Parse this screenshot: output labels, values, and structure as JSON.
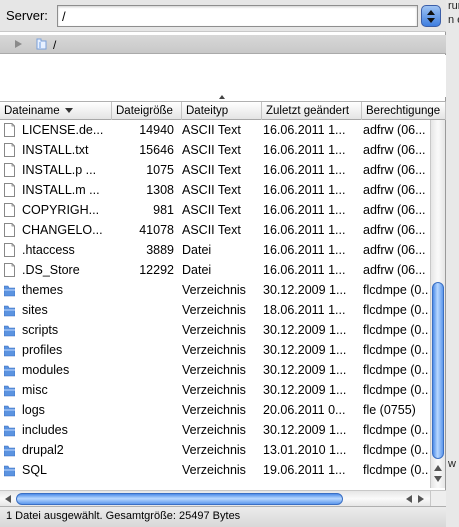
{
  "server": {
    "label": "Server:",
    "value": "/"
  },
  "path": {
    "text": "/"
  },
  "columns": [
    "Dateiname",
    "Dateigröße",
    "Dateityp",
    "Zuletzt geändert",
    "Berechtigunge"
  ],
  "files": [
    {
      "name": "LICENSE.de...",
      "size": "14940",
      "type": "ASCII Text",
      "modified": "16.06.2011 1...",
      "perm": "adfrw (06...",
      "kind": "file"
    },
    {
      "name": "INSTALL.txt",
      "size": "15646",
      "type": "ASCII Text",
      "modified": "16.06.2011 1...",
      "perm": "adfrw (06...",
      "kind": "file"
    },
    {
      "name": "INSTALL.p ...",
      "size": "1075",
      "type": "ASCII Text",
      "modified": "16.06.2011 1...",
      "perm": "adfrw (06...",
      "kind": "file"
    },
    {
      "name": "INSTALL.m ...",
      "size": "1308",
      "type": "ASCII Text",
      "modified": "16.06.2011 1...",
      "perm": "adfrw (06...",
      "kind": "file"
    },
    {
      "name": "COPYRIGH...",
      "size": "981",
      "type": "ASCII Text",
      "modified": "16.06.2011 1...",
      "perm": "adfrw (06...",
      "kind": "file"
    },
    {
      "name": "CHANGELO...",
      "size": "41078",
      "type": "ASCII Text",
      "modified": "16.06.2011 1...",
      "perm": "adfrw (06...",
      "kind": "file"
    },
    {
      "name": ".htaccess",
      "size": "3889",
      "type": "Datei",
      "modified": "16.06.2011 1...",
      "perm": "adfrw (06...",
      "kind": "file"
    },
    {
      "name": ".DS_Store",
      "size": "12292",
      "type": "Datei",
      "modified": "16.06.2011 1...",
      "perm": "adfrw (06...",
      "kind": "file"
    },
    {
      "name": "themes",
      "size": "",
      "type": "Verzeichnis",
      "modified": "30.12.2009 1...",
      "perm": "flcdmpe (0...",
      "kind": "folder"
    },
    {
      "name": "sites",
      "size": "",
      "type": "Verzeichnis",
      "modified": "18.06.2011 1...",
      "perm": "flcdmpe (0...",
      "kind": "folder"
    },
    {
      "name": "scripts",
      "size": "",
      "type": "Verzeichnis",
      "modified": "30.12.2009 1...",
      "perm": "flcdmpe (0...",
      "kind": "folder"
    },
    {
      "name": "profiles",
      "size": "",
      "type": "Verzeichnis",
      "modified": "30.12.2009 1...",
      "perm": "flcdmpe (0...",
      "kind": "folder"
    },
    {
      "name": "modules",
      "size": "",
      "type": "Verzeichnis",
      "modified": "30.12.2009 1...",
      "perm": "flcdmpe (0...",
      "kind": "folder"
    },
    {
      "name": "misc",
      "size": "",
      "type": "Verzeichnis",
      "modified": "30.12.2009 1...",
      "perm": "flcdmpe (0...",
      "kind": "folder"
    },
    {
      "name": "logs",
      "size": "",
      "type": "Verzeichnis",
      "modified": "20.06.2011 0...",
      "perm": "fle (0755)",
      "kind": "folder"
    },
    {
      "name": "includes",
      "size": "",
      "type": "Verzeichnis",
      "modified": "30.12.2009 1...",
      "perm": "flcdmpe (0...",
      "kind": "folder"
    },
    {
      "name": "drupal2",
      "size": "",
      "type": "Verzeichnis",
      "modified": "13.01.2010 1...",
      "perm": "flcdmpe (0...",
      "kind": "folder"
    },
    {
      "name": "SQL",
      "size": "",
      "type": "Verzeichnis",
      "modified": "19.06.2011 1...",
      "perm": "flcdmpe (0...",
      "kind": "folder"
    }
  ],
  "status": "1 Datei ausgewählt. Gesamtgröße: 25497 Bytes",
  "background_fragments": [
    "run",
    "n e",
    "w"
  ],
  "colors": {
    "folder": "#5b93e0",
    "scroll_thumb": "#6aa2f0"
  }
}
